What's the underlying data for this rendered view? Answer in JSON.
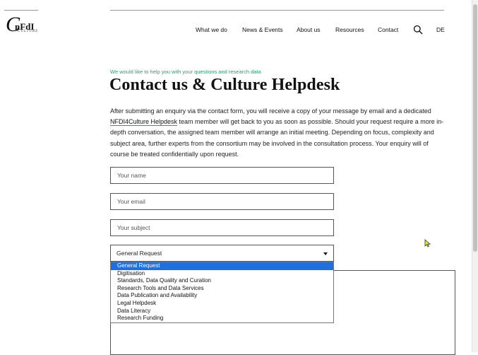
{
  "header": {
    "logo_text": "nFdI",
    "logo_subtext": "CULTURE",
    "nav": [
      {
        "label": "What we do"
      },
      {
        "label": "News & Events"
      },
      {
        "label": "About us"
      },
      {
        "label": "Resources"
      },
      {
        "label": "Contact"
      }
    ],
    "search_icon": "search-icon",
    "language": "DE"
  },
  "main": {
    "eyebrow": "We would like to help you with your questions and research data",
    "title": "Contact us & Culture Helpdesk",
    "intro_before_link": "After submitting an enquiry via the contact form, you will receive a copy of your message by email and a dedicated ",
    "intro_link": "NFDI4Culture Helpdesk",
    "intro_after_link": " team member will get back to you as soon as possible. Should your request require a more in-depth conversation, the assigned team member will arrange an initial meeting. Depending on focus, complexity and subject area, further experts from the consortium may be involved in the consultation process. Your enquiry will of course be treated confidentially upon request."
  },
  "form": {
    "name_placeholder": "Your name",
    "email_placeholder": "Your email",
    "subject_placeholder": "Your subject",
    "topic_selected": "General Request",
    "topic_options": [
      "General Request",
      "Digitisation",
      "Standards, Data Quality and Curation",
      "Research Tools and Data Services",
      "Data Publication and Availability",
      "Legal Helpdesk",
      "Data Literacy",
      "Research Funding"
    ]
  },
  "colors": {
    "accent_green": "#2e9e6e",
    "selection_blue": "#1e6fe0"
  }
}
